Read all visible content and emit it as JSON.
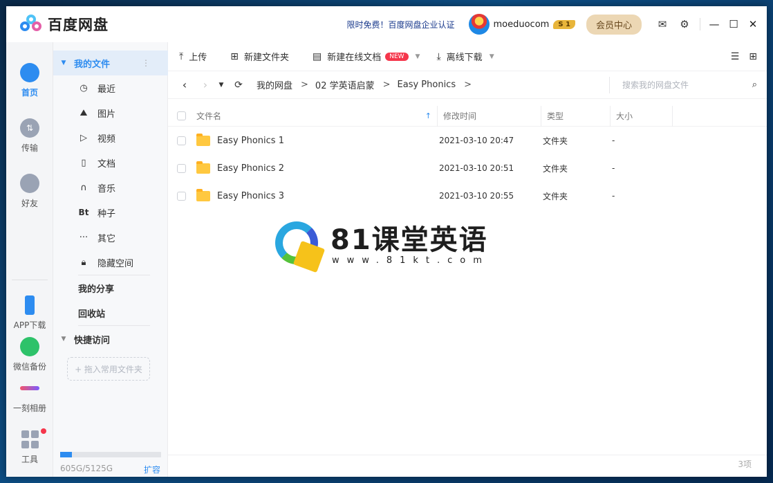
{
  "app": {
    "name": "百度网盘",
    "promo": "限时免费！百度网盘企业认证",
    "username": "moeduocom",
    "vip_level": "S 1",
    "member_center": "会员中心"
  },
  "rail": {
    "items": [
      {
        "label": "首页"
      },
      {
        "label": "传输"
      },
      {
        "label": "好友"
      },
      {
        "label": "APP下载"
      },
      {
        "label": "微信备份"
      },
      {
        "label": "一刻相册"
      },
      {
        "label": "工具"
      }
    ]
  },
  "sidebar": {
    "my_files": "我的文件",
    "categories": [
      {
        "label": "最近",
        "icon": "clock-icon"
      },
      {
        "label": "图片",
        "icon": "image-icon"
      },
      {
        "label": "视频",
        "icon": "play-icon"
      },
      {
        "label": "文档",
        "icon": "document-icon"
      },
      {
        "label": "音乐",
        "icon": "headphones-icon"
      },
      {
        "label": "种子",
        "icon": "bt-icon"
      },
      {
        "label": "其它",
        "icon": "more-icon"
      },
      {
        "label": "隐藏空间",
        "icon": "lock-icon"
      }
    ],
    "bt_glyph": "Bt",
    "my_share": "我的分享",
    "recycle_bin": "回收站",
    "quick_access": "快捷访问",
    "drag_hint": "+ 拖入常用文件夹",
    "quota_text": "605G/5125G",
    "quota_used_fraction": 0.118,
    "expand": "扩容"
  },
  "toolbar": {
    "upload": "上传",
    "new_folder": "新建文件夹",
    "new_online_doc": "新建在线文档",
    "new_badge": "NEW",
    "offline_download": "离线下载"
  },
  "breadcrumb": {
    "items": [
      "我的网盘",
      "02 学英语启蒙",
      "Easy Phonics"
    ],
    "separator": ">"
  },
  "search": {
    "placeholder": "搜索我的网盘文件"
  },
  "table": {
    "headers": {
      "name": "文件名",
      "modified": "修改时间",
      "type": "类型",
      "size": "大小"
    },
    "rows": [
      {
        "name": "Easy Phonics 1",
        "modified": "2021-03-10 20:47",
        "type": "文件夹",
        "size": "-"
      },
      {
        "name": "Easy Phonics 2",
        "modified": "2021-03-10 20:51",
        "type": "文件夹",
        "size": "-"
      },
      {
        "name": "Easy Phonics 3",
        "modified": "2021-03-10 20:55",
        "type": "文件夹",
        "size": "-"
      }
    ]
  },
  "status": {
    "count": "3项"
  },
  "watermark": {
    "title": "81课堂英语",
    "url": "www.81kt.com"
  },
  "colors": {
    "accent": "#2d8cf0",
    "folder": "#ffc840",
    "badge_red": "#f5364b",
    "member_bg": "#ecd7b4"
  }
}
